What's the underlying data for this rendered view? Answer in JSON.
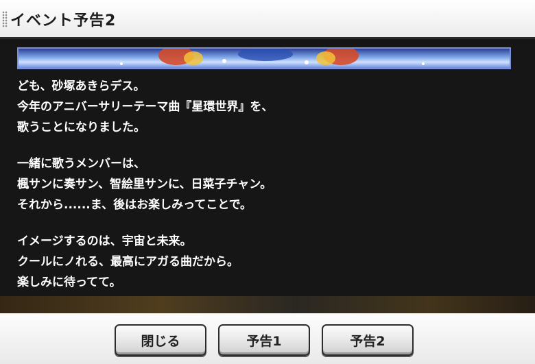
{
  "header": {
    "title": "イベント予告2"
  },
  "message": {
    "paragraphs": [
      {
        "lines": [
          "ども、砂塚あきらデス。",
          "今年のアニバーサリーテーマ曲『星環世界』を、",
          "歌うことになりました。"
        ]
      },
      {
        "lines": [
          "一緒に歌うメンバーは、",
          "楓サンに奏サン、智絵里サンに、日菜子チャン。",
          "それから......ま、後はお楽しみってことで。"
        ]
      },
      {
        "lines": [
          "イメージするのは、宇宙と未来。",
          "クールにノれる、最高にアガる曲だから。",
          "楽しみに待ってて。"
        ]
      }
    ]
  },
  "footer": {
    "close_label": "閉じる",
    "preview1_label": "予告1",
    "preview2_label": "予告2"
  }
}
